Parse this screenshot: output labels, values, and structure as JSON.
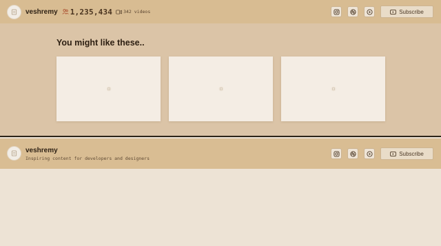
{
  "header": {
    "channel_name": "veshremy",
    "subscriber_count": "1,235,434",
    "video_count": "342 videos",
    "subscribe_label": "Subscribe",
    "icons": [
      "user-avatar-icon",
      "subscribers-icon",
      "video-camera-icon",
      "instagram-icon",
      "dribbble-icon",
      "play-icon",
      "youtube-icon"
    ]
  },
  "recommendations": {
    "title": "You might like these..",
    "cards": [
      {
        "name": "card-1",
        "icon": "image-placeholder-icon"
      },
      {
        "name": "card-2",
        "icon": "image-placeholder-icon"
      },
      {
        "name": "card-3",
        "icon": "image-placeholder-icon"
      }
    ]
  },
  "channel_bar": {
    "channel_name": "veshremy",
    "tagline": "Inspiring content for developers and designers",
    "subscribe_label": "Subscribe"
  },
  "colors": {
    "header_bg": "#d8bc92",
    "panel_bg": "#dbc4a7",
    "page_bg": "#ede3d5",
    "card_bg": "#f4ede4",
    "divider": "#2d2418"
  }
}
